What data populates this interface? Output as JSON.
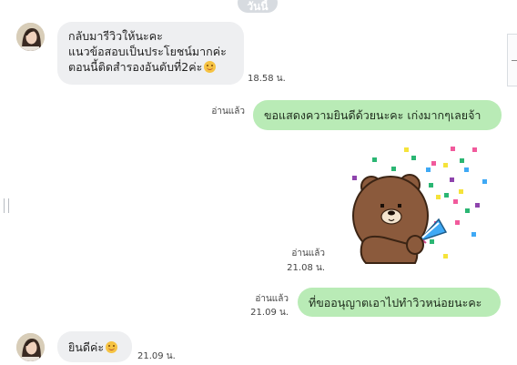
{
  "date_divider": "วันนี้",
  "messages": [
    {
      "side": "in",
      "lines": [
        "กลับมารีวิวให้นะคะ",
        "แนวข้อสอบเป็นประโยชน์มากค่ะ",
        "ตอนนี้ติดสำรองอันดับที่2ค่ะ"
      ],
      "emoji": "smiling-face",
      "time": "18.58 น."
    },
    {
      "side": "out",
      "text": "ขอแสดงความยินดีด้วยนะคะ เก่งมากๆเลยจ้า",
      "read": "อ่านแล้ว",
      "time": ""
    },
    {
      "side": "out",
      "sticker": "brown-bear-party-popper",
      "read": "อ่านแล้ว",
      "time": "21.08 น."
    },
    {
      "side": "out",
      "text": "ที่ขออนุญาตเอาไปทำวิวหน่อยนะคะ",
      "read": "อ่านแล้ว",
      "time": "21.09 น."
    },
    {
      "side": "in",
      "text": "ยินดีค่ะ",
      "emoji": "smiling-face",
      "time": "21.09 น."
    }
  ],
  "colors": {
    "outgoing_bubble": "#b9ebb6",
    "incoming_bubble": "#eeeff1",
    "date_pill": "#d7dbe0"
  }
}
